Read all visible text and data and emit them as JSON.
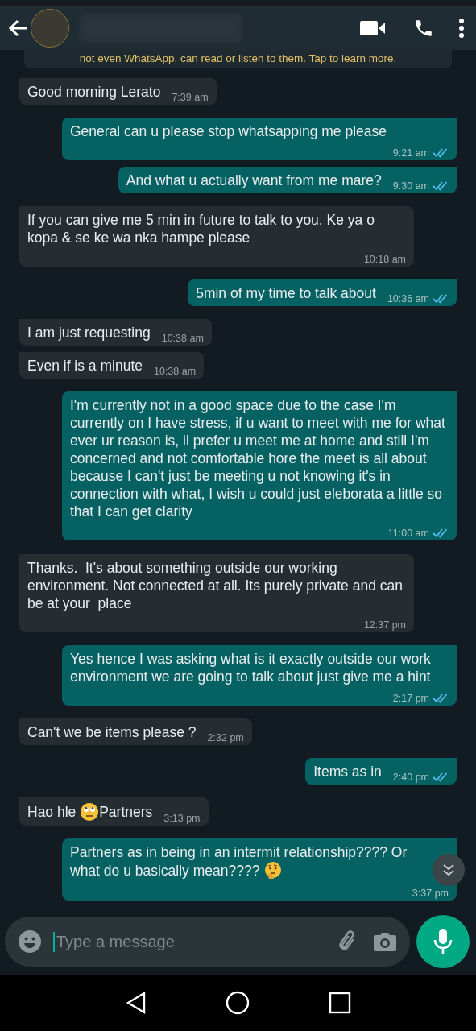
{
  "header": {
    "back": true
  },
  "encryption_notice": {
    "text": "not even WhatsApp, can read or listen to them. Tap to learn more."
  },
  "messages": [
    {
      "kind": "incoming",
      "text": "Good morning Lerato",
      "time": "7:39 am"
    },
    {
      "kind": "outgoing",
      "text": "General can u please stop whatsapping me please",
      "time": "9:21 am",
      "read": true
    },
    {
      "kind": "outgoing",
      "text": "And what u actually want from me mare?",
      "time": "9:30 am",
      "read": true
    },
    {
      "kind": "incoming",
      "text": "If you can give me 5 min in future to talk to you. Ke ya o kopa & se ke wa nka hampe please",
      "time": "10:18 am"
    },
    {
      "kind": "outgoing",
      "text": "5min of my time to talk about",
      "time": "10:36 am",
      "read": true
    },
    {
      "kind": "incoming",
      "text": "I am just requesting",
      "time": "10:38 am"
    },
    {
      "kind": "incoming",
      "text": "Even if is a minute",
      "time": "10:38 am"
    },
    {
      "kind": "outgoing",
      "text": "I'm currently not in a good space due to the case I'm currently on I have stress, if u want to meet with me for what ever ur reason is, il prefer u meet me at home and still I'm concerned and not comfortable hore the meet is all about because I can't just be meeting u not knowing it's in connection with what, I wish u could just eleborata a little so that I can get clarity",
      "time": "11:00 am",
      "read": true
    },
    {
      "kind": "incoming",
      "text": "Thanks.  It's about something outside our working environment. Not connected at all. Its purely private and can be at your  place",
      "time": "12:37 pm"
    },
    {
      "kind": "outgoing",
      "text": "Yes hence I was asking what is it exactly outside our work environment we are going to talk about just give me a hint",
      "time": "2:17 pm",
      "read": true
    },
    {
      "kind": "incoming",
      "text": "Can't we be items please ?",
      "time": "2:32 pm"
    },
    {
      "kind": "outgoing",
      "text": "Items as in",
      "time": "2:40 pm",
      "read": true
    },
    {
      "kind": "incoming",
      "lines": [
        [
          {
            "kind": "text",
            "text": "Hao hle "
          },
          {
            "kind": "eye-roll"
          },
          {
            "kind": "text",
            "text": "Partners"
          }
        ]
      ],
      "time": "3:13 pm"
    },
    {
      "kind": "outgoing",
      "lines": [
        [
          {
            "kind": "text",
            "text": "Partners as in being in an intermit relationship???? Or"
          }
        ],
        [
          {
            "kind": "text",
            "text": "what do u basically mean???? "
          },
          {
            "kind": "thinking"
          }
        ]
      ],
      "time": "3:37 pm",
      "read": false
    }
  ],
  "composer": {
    "placeholder": "Type a message"
  }
}
